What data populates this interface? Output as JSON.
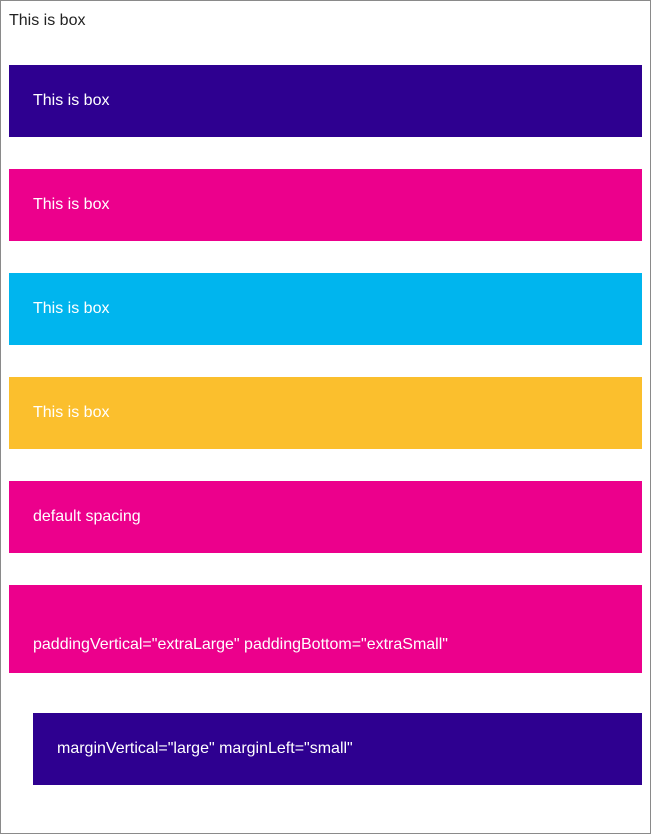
{
  "colors": {
    "purple": "#2e0090",
    "magenta": "#ec008c",
    "cyan": "#00b5ee",
    "yellow": "#fbbf2d",
    "text_on_color": "#ffffff",
    "text_plain": "#222222"
  },
  "boxes": {
    "plain": {
      "label": "This is box"
    },
    "purple": {
      "label": "This is box"
    },
    "magenta": {
      "label": "This is box"
    },
    "cyan": {
      "label": "This is box"
    },
    "yellow": {
      "label": "This is box"
    },
    "default_spacing": {
      "label": "default spacing"
    },
    "padding_example": {
      "label": "paddingVertical=\"extraLarge\" paddingBottom=\"extraSmall\""
    },
    "margin_example": {
      "label": "marginVertical=\"large\" marginLeft=\"small\""
    }
  }
}
